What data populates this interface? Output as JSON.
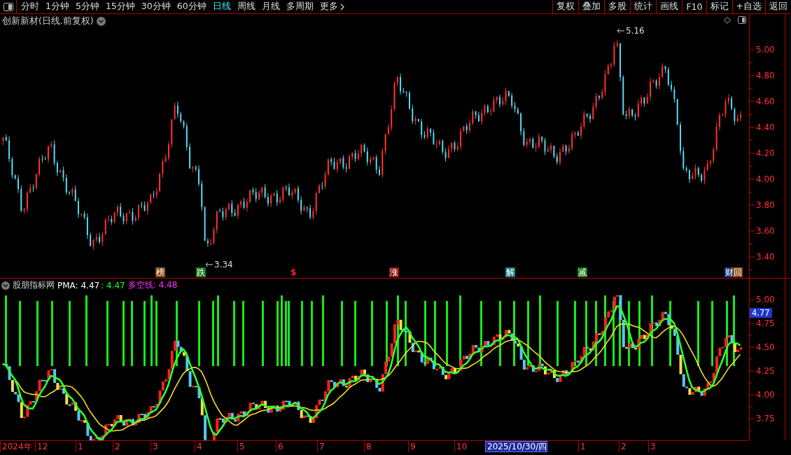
{
  "toolbar": {
    "periods": [
      {
        "label": "分时",
        "selected": false
      },
      {
        "label": "1分钟",
        "selected": false
      },
      {
        "label": "5分钟",
        "selected": false
      },
      {
        "label": "15分钟",
        "selected": false
      },
      {
        "label": "30分钟",
        "selected": false
      },
      {
        "label": "60分钟",
        "selected": false
      },
      {
        "label": "日线",
        "selected": true
      },
      {
        "label": "周线",
        "selected": false
      },
      {
        "label": "月线",
        "selected": false
      },
      {
        "label": "多周期",
        "selected": false
      },
      {
        "label": "更多",
        "selected": false
      }
    ],
    "actions": [
      "复权",
      "叠加",
      "多股",
      "统计",
      "画线",
      "F10",
      "标记",
      "+自选",
      "返回"
    ]
  },
  "price_panel": {
    "title": "创新新材(日线.前复权)",
    "high_label": "5.16",
    "low_label": "3.34",
    "axis_labels": [
      "5.00",
      "4.80",
      "4.60",
      "4.40",
      "4.20",
      "4.00",
      "3.80",
      "3.60",
      "3.40"
    ],
    "event_marks": [
      {
        "label": "榜",
        "kind": "tag",
        "color": "#8b4a12"
      },
      {
        "label": "跌",
        "kind": "tag",
        "color": "#1a7a1a"
      },
      {
        "label": "$",
        "kind": "symbol",
        "color": "#ff2020"
      },
      {
        "label": "涨",
        "kind": "tag",
        "color": "#8a1010"
      },
      {
        "label": "解",
        "kind": "tag",
        "color": "#108080"
      },
      {
        "label": "减",
        "kind": "tag",
        "color": "#1a7a1a"
      },
      {
        "label": "财",
        "kind": "tag",
        "color": "#1a3a80"
      },
      {
        "label": "回",
        "kind": "tag",
        "color": "#8b4a12"
      }
    ]
  },
  "indicator_panel": {
    "name": "股朋指标网",
    "pma": "PMA: 4.47",
    "pma_short": ": 4.47",
    "long_short_line": "多空线: 4.48",
    "current_value": "4.77",
    "axis_labels": [
      "5.00",
      "4.75",
      "4.50",
      "4.25",
      "4.00",
      "3.75"
    ]
  },
  "date_axis": [
    {
      "label": "2024年",
      "selected": false
    },
    {
      "label": "12",
      "selected": false
    },
    {
      "label": "1",
      "selected": false
    },
    {
      "label": "2",
      "selected": false
    },
    {
      "label": "3",
      "selected": false
    },
    {
      "label": "4",
      "selected": false
    },
    {
      "label": "5",
      "selected": false
    },
    {
      "label": "6",
      "selected": false
    },
    {
      "label": "7",
      "selected": false
    },
    {
      "label": "8",
      "selected": false
    },
    {
      "label": "9",
      "selected": false
    },
    {
      "label": "10",
      "selected": false
    },
    {
      "label": "2025/10/30/四",
      "selected": true
    },
    {
      "label": "1",
      "selected": false
    },
    {
      "label": "2",
      "selected": false
    },
    {
      "label": "3",
      "selected": false
    }
  ]
}
